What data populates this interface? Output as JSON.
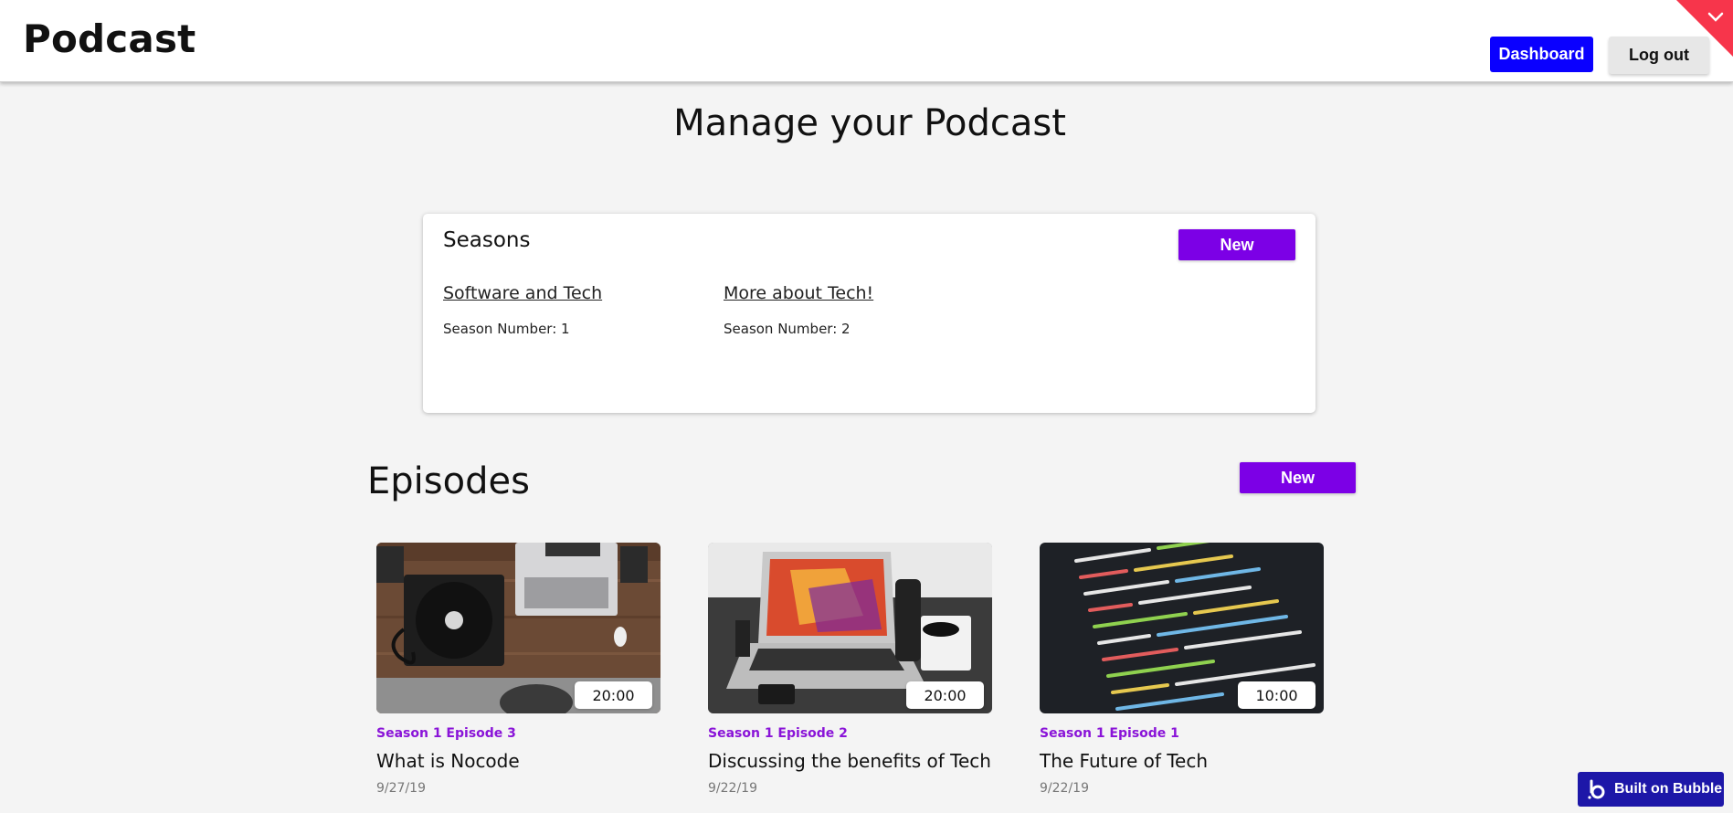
{
  "header": {
    "brand": "Podcast",
    "dashboard_label": "Dashboard",
    "logout_label": "Log out",
    "corner_icon": "chevron-down-icon",
    "corner_color": "#f7354b"
  },
  "main": {
    "title": "Manage your Podcast"
  },
  "seasons": {
    "title": "Seasons",
    "new_label": "New",
    "items": [
      {
        "name": "Software and Tech",
        "number_text": "Season Number: 1"
      },
      {
        "name": "More about Tech!",
        "number_text": "Season Number: 2"
      }
    ]
  },
  "episodes": {
    "title": "Episodes",
    "new_label": "New",
    "items": [
      {
        "meta": "Season 1 Episode 3",
        "title": "What is Nocode",
        "date": "9/27/19",
        "duration": "20:00",
        "thumbnail": "desk-turntable-laptop-image"
      },
      {
        "meta": "Season 1 Episode 2",
        "title": "Discussing the benefits of Tech",
        "date": "9/22/19",
        "duration": "20:00",
        "thumbnail": "laptop-desk-image"
      },
      {
        "meta": "Season 1 Episode 1",
        "title": "The Future of Tech",
        "date": "9/22/19",
        "duration": "10:00",
        "thumbnail": "code-screen-image"
      }
    ]
  },
  "badge": {
    "label": "Built on Bubble",
    "icon": "bubble-logo-icon"
  },
  "colors": {
    "dashboard_button": "#0a00ff",
    "new_button": "#7c00e6",
    "episode_meta": "#8a14d8",
    "bubble_badge": "#1d17a8",
    "background": "#f4f4f4"
  }
}
